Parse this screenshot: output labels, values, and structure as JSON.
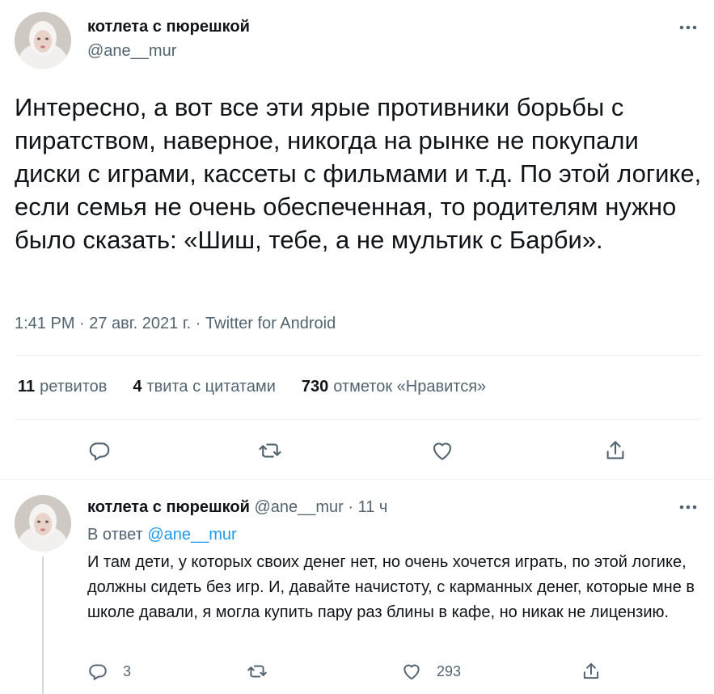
{
  "tweet": {
    "author_name": "котлета с пюрешкой",
    "author_handle": "@ane__mur",
    "text": "Интересно, а вот все эти ярые противники борьбы с пиратством, наверное, никогда на рынке не покупали диски с играми, кассеты с фильмами и т.д. По этой логике, если семья не очень обеспеченная, то родителям нужно было сказать: «Шиш, тебе, а не мультик с Барби».",
    "timestamp": "1:41 PM · 27 авг. 2021 г. · Twitter for Android",
    "stats": {
      "retweets_count": "11",
      "retweets_label": "ретвитов",
      "quotes_count": "4",
      "quotes_label": "твита с цитатами",
      "likes_count": "730",
      "likes_label": "отметок «Нравится»"
    },
    "actions": [
      "reply-icon",
      "retweet-icon",
      "like-icon",
      "share-icon"
    ]
  },
  "reply": {
    "author_name": "котлета с пюрешкой",
    "author_handle": "@ane__mur",
    "time": "· 11 ч",
    "reply_to_label": "В ответ",
    "reply_to_handle": "@ane__mur",
    "text": "И там дети, у которых своих денег нет, но очень хочется играть, по этой логике, должны сидеть без игр. И, давайте начистоту, с карманных денег, которые мне в школе давали, я могла купить пару раз блины в кафе, но никак не лицензию.",
    "reply_count": "3",
    "like_count": "293"
  },
  "colors": {
    "text": "#0f1419",
    "secondary": "#536471",
    "link": "#1d9bf0",
    "divider": "#eff3f4"
  }
}
